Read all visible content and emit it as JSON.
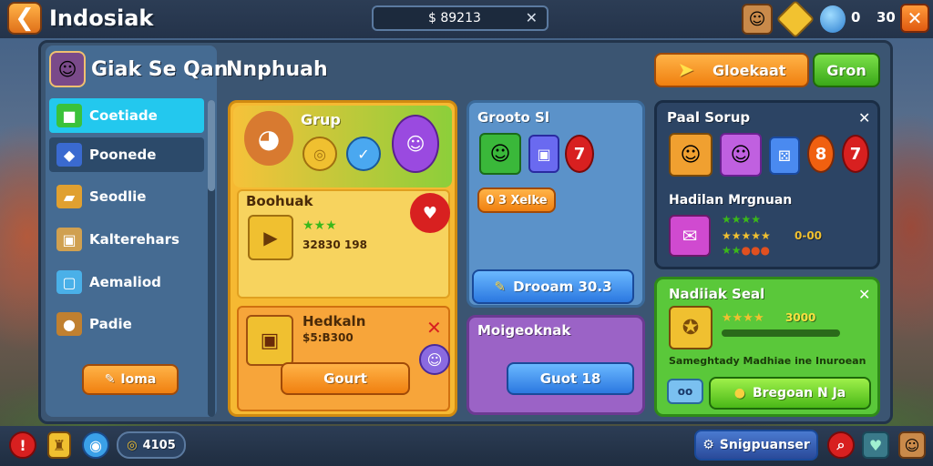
{
  "topbar": {
    "title": "Indosiak",
    "search_value": "$ 89213",
    "currency_a": "0",
    "currency_b": "30"
  },
  "panel": {
    "title": "Giak Se Qan",
    "subtitle": "Nnphuah"
  },
  "sidebar": {
    "items": [
      {
        "label": "Coetiade"
      },
      {
        "label": "Poonede"
      },
      {
        "label": "Seodlie"
      },
      {
        "label": "Kalterehars"
      },
      {
        "label": "Aemaliod"
      },
      {
        "label": "Padie"
      }
    ],
    "button_label": "Ioma"
  },
  "header_buttons": {
    "primary": "Gloekaat",
    "secondary": "Gron"
  },
  "yellow_card": {
    "title": "Grup",
    "item1_title": "Boohuak",
    "item1_price": "32830 198",
    "item2_title": "Hedkaln",
    "item2_price": "$5:B300",
    "button": "Gourt"
  },
  "blue_card": {
    "title": "Grooto Sl",
    "badge": "7",
    "small_button": "0 3 Xelke",
    "wide_button": "Drooam 30.3"
  },
  "purple_card": {
    "title": "Moigeoknak",
    "button": "Guot 18"
  },
  "dark_card": {
    "title": "Paal Sorup",
    "badge_a": "8",
    "badge_b": "7",
    "item_title": "Hadilan Mrgnuan",
    "stars_value": "0-00"
  },
  "green_card": {
    "title": "Nadiiak Seal",
    "stars_value": "3000",
    "description": "Sameghtady Madhiae ine Inuroean",
    "button": "Bregoan N Ja"
  },
  "bottombar": {
    "coin_value": "4105",
    "right_button": "Snigpuanser"
  }
}
